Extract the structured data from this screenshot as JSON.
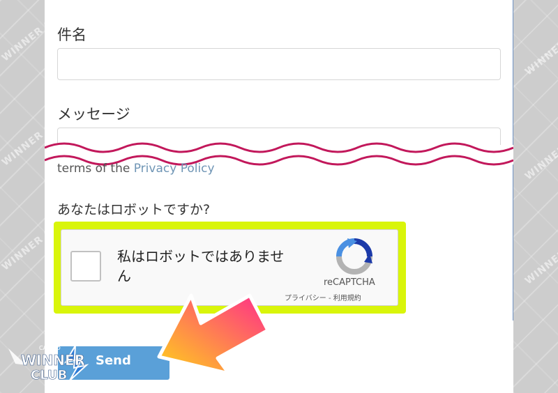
{
  "form": {
    "subject_label": "件名",
    "subject_value": "",
    "message_label": "メッセージ",
    "message_value": "",
    "terms_prefix": "terms of the",
    "privacy_link": "Privacy Policy",
    "robot_question": "あなたはロボットですか?",
    "send_label": "Send"
  },
  "recaptcha": {
    "checkbox_label": "私はロボットではありません",
    "brand": "reCAPTCHA",
    "links": "プライバシー - 利用規約",
    "checked": false
  },
  "watermark": {
    "text": "WINNER CLUB",
    "logo_top": "CASINO",
    "logo_main": "WINNER",
    "logo_sub": "CLUB"
  },
  "colors": {
    "highlight": "#d9f50a",
    "wave": "#c2185b",
    "button": "#5aa0d8",
    "link": "#6f95b5",
    "arrow_start": "#ffd21a",
    "arrow_end": "#ff2d8a"
  }
}
